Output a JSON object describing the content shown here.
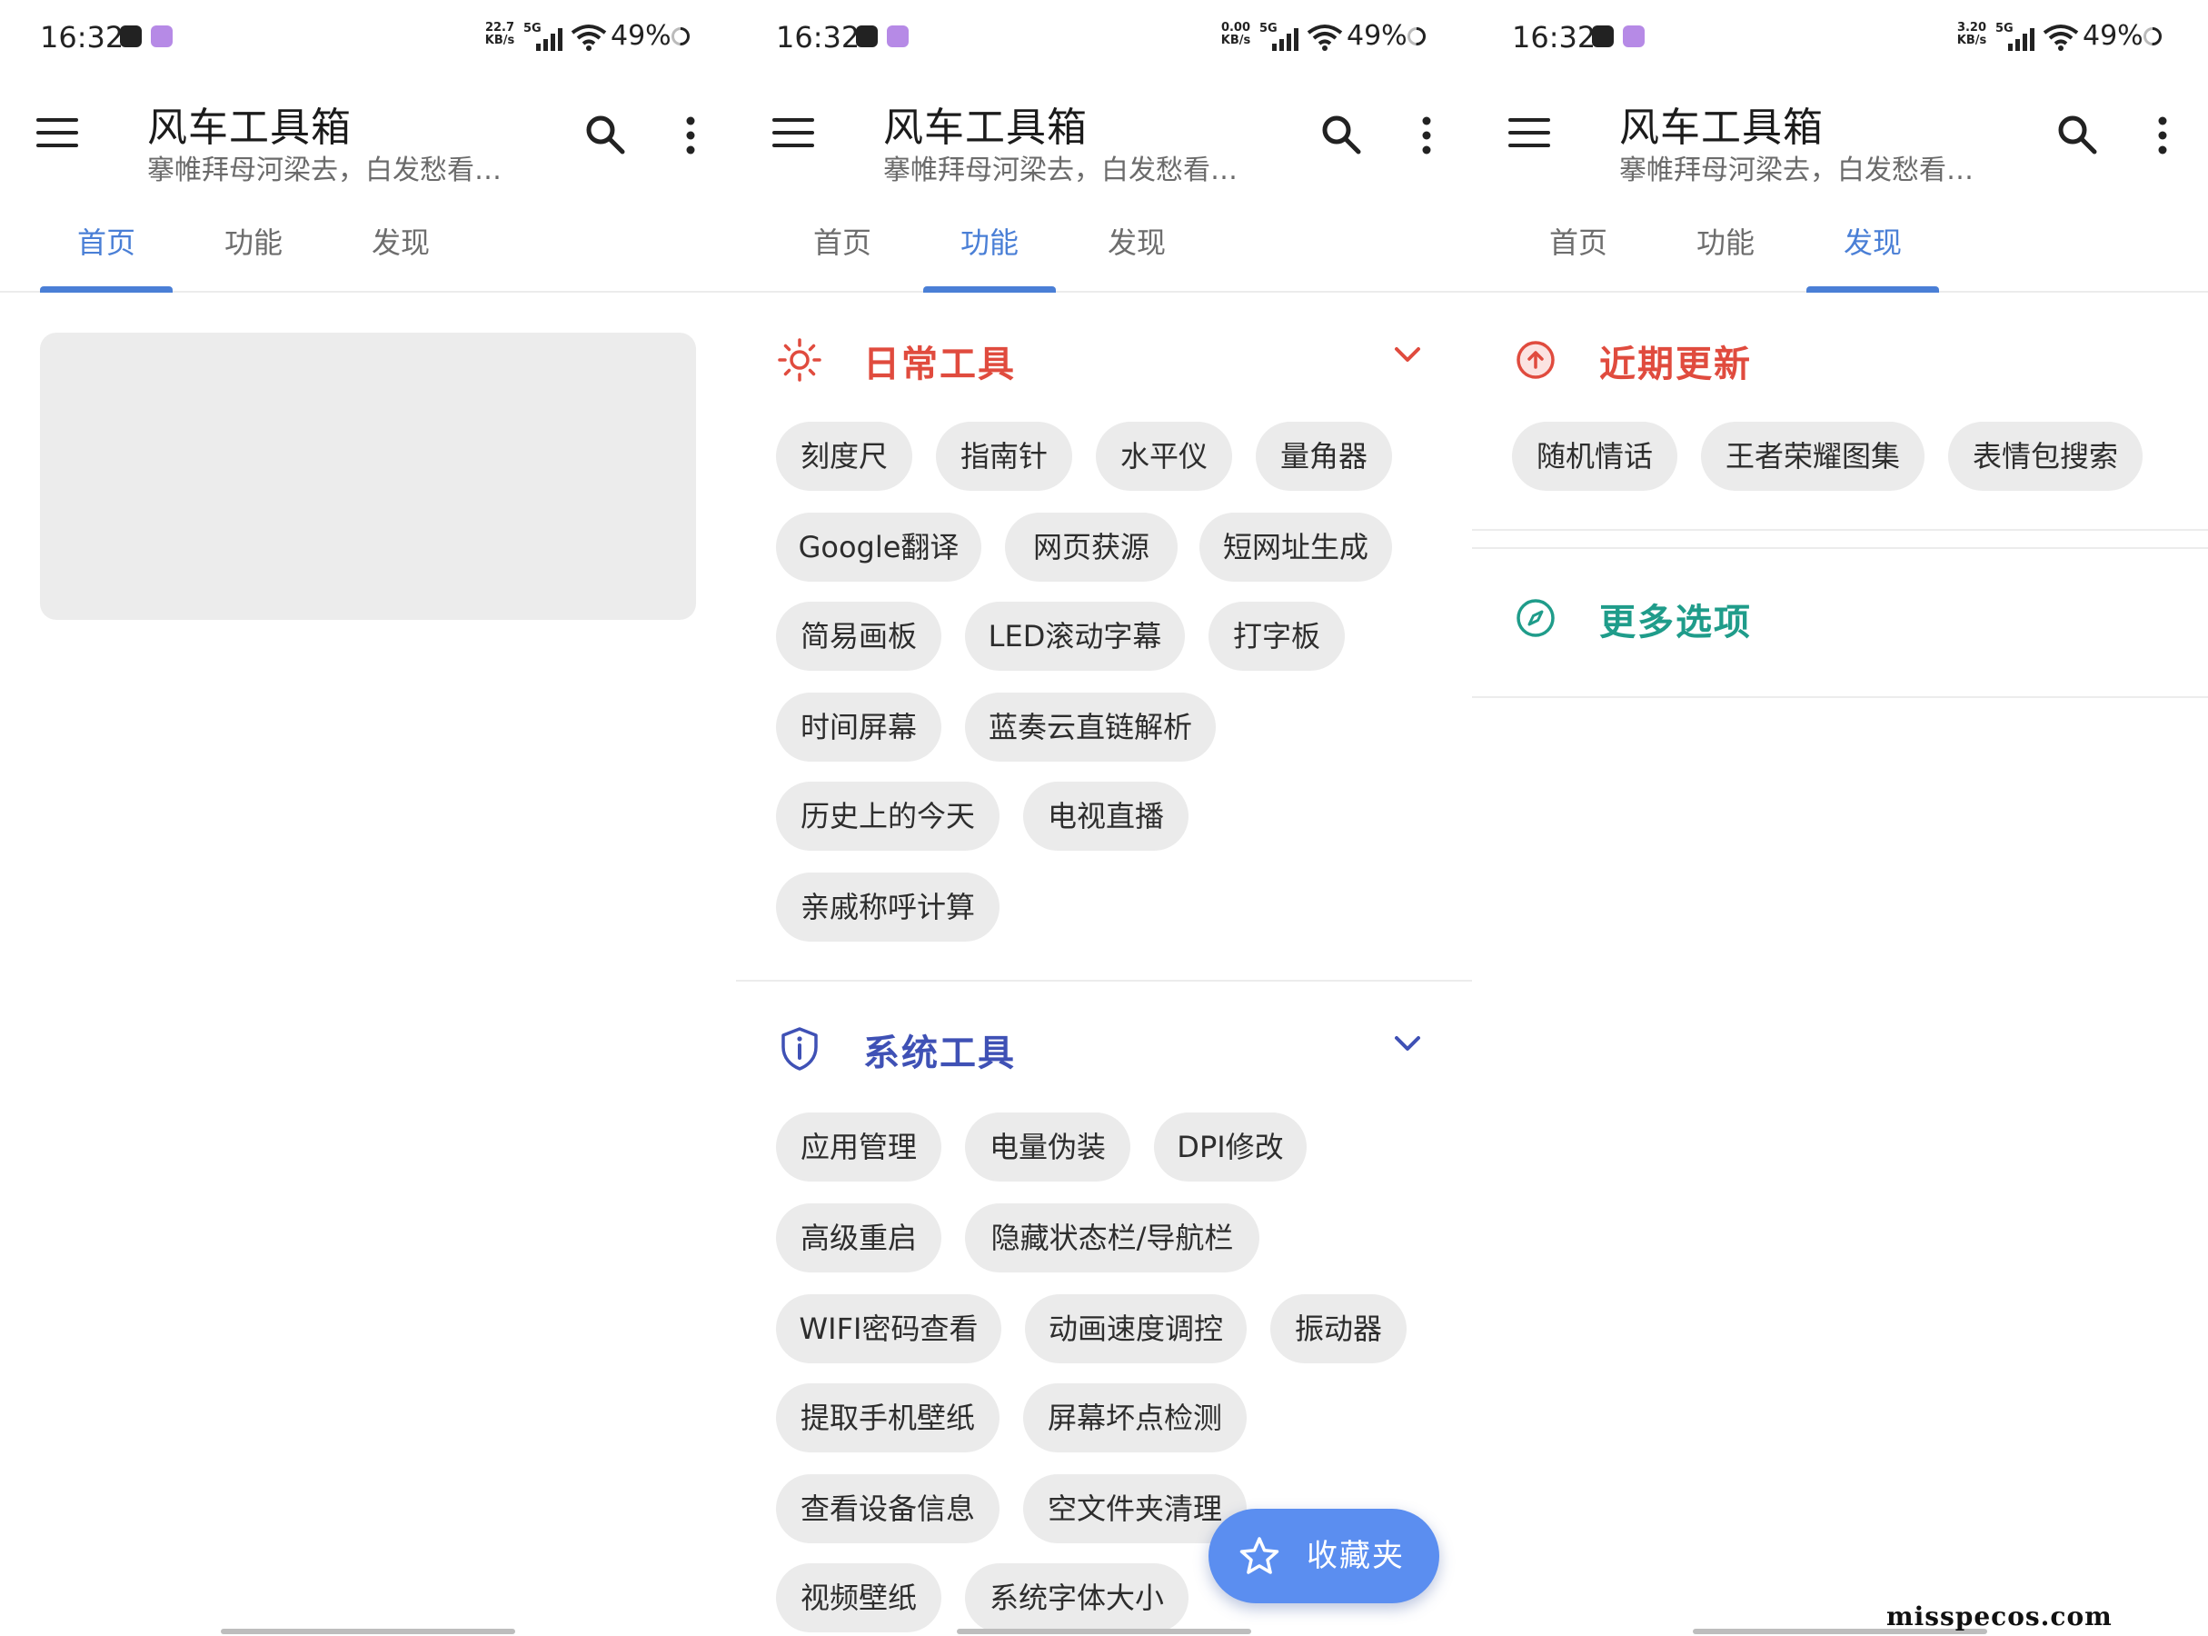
{
  "status": {
    "time": "16:32",
    "battery": "49%",
    "network": "5G",
    "speeds": [
      "22.7\nKB/s",
      "0.00\nKB/s",
      "3.20\nKB/s"
    ]
  },
  "app": {
    "title": "风车工具箱",
    "subtitle": "搴帷拜母河梁去，白发愁看…",
    "tabs": [
      "首页",
      "功能",
      "发现"
    ],
    "accent": "#4a7fd6"
  },
  "features": {
    "daily": {
      "title": "日常工具",
      "color": "#e04b3e",
      "rows": [
        [
          "刻度尺",
          "指南针",
          "水平仪",
          "量角器"
        ],
        [
          "Google翻译",
          "网页获源",
          "短网址生成"
        ],
        [
          "简易画板",
          "LED滚动字幕",
          "打字板"
        ],
        [
          "时间屏幕",
          "蓝奏云直链解析"
        ],
        [
          "历史上的今天",
          "电视直播"
        ],
        [
          "亲戚称呼计算"
        ]
      ]
    },
    "system": {
      "title": "系统工具",
      "color": "#3f51b5",
      "rows": [
        [
          "应用管理",
          "电量伪装",
          "DPI修改"
        ],
        [
          "高级重启",
          "隐藏状态栏/导航栏"
        ],
        [
          "WIFI密码查看",
          "动画速度调控",
          "振动器"
        ],
        [
          "提取手机壁纸",
          "屏幕坏点检测"
        ],
        [
          "查看设备信息",
          "空文件夹清理"
        ],
        [
          "视频壁纸",
          "系统字体大小"
        ]
      ]
    },
    "fab_label": "收藏夹"
  },
  "discover": {
    "recent": {
      "title": "近期更新",
      "color": "#e04b3e",
      "items": [
        "随机情话",
        "王者荣耀图集",
        "表情包搜索"
      ]
    },
    "more": {
      "title": "更多选项",
      "color": "#1f9c8a"
    }
  },
  "watermark": "misspecos.com",
  "icons": {
    "menu": "hamburger-icon",
    "search": "search-icon",
    "more": "more-vert-icon",
    "daily": "sun-icon",
    "system": "shield-info-icon",
    "recent": "arrow-up-circle-icon",
    "more_options": "compass-icon",
    "fab": "star-icon"
  }
}
